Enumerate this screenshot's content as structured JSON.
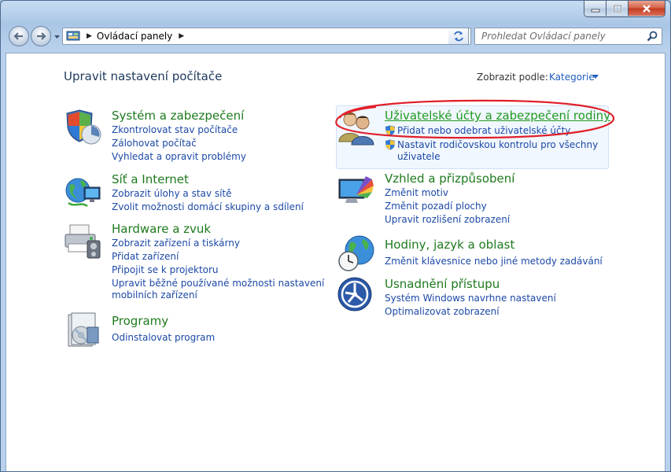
{
  "window": {
    "caption": {
      "minimize": "minimize",
      "maximize": "maximize",
      "close": "close"
    }
  },
  "navbar": {
    "address": "Ovládací panely",
    "search_placeholder": "Prohledat Ovládací panely"
  },
  "header": {
    "title": "Upravit nastavení počítače",
    "view_by_label": "Zobrazit podle:",
    "view_by_value": "Kategorie"
  },
  "categories": {
    "system": {
      "title": "Systém a zabezpečení",
      "links": [
        "Zkontrolovat stav počítače",
        "Zálohovat počítač",
        "Vyhledat a opravit problémy"
      ]
    },
    "network": {
      "title": "Síť a Internet",
      "links": [
        "Zobrazit úlohy a stav sítě",
        "Zvolit možnosti domácí skupiny a sdílení"
      ]
    },
    "hardware": {
      "title": "Hardware a zvuk",
      "links": [
        "Zobrazit zařízení a tiskárny",
        "Přidat zařízení",
        "Připojit se k projektoru",
        "Upravit běžné používané možnosti nastavení",
        "mobilních zařízení"
      ]
    },
    "programs": {
      "title": "Programy",
      "links": [
        "Odinstalovat program"
      ]
    },
    "users": {
      "title": "Uživatelské účty a zabezpečení rodiny",
      "links": [
        "Přidat nebo odebrat uživatelské účty",
        "Nastavit rodičovskou kontrolu pro všechny",
        "uživatele"
      ]
    },
    "appearance": {
      "title": "Vzhled a přizpůsobení",
      "links": [
        "Změnit motiv",
        "Změnit pozadí plochy",
        "Upravit rozlišení zobrazení"
      ]
    },
    "clock": {
      "title": "Hodiny, jazyk a oblast",
      "links": [
        "Změnit klávesnice nebo jiné metody zadávání"
      ]
    },
    "access": {
      "title": "Usnadnění přístupu",
      "links": [
        "Systém Windows navrhne nastavení",
        "Optimalizovat zobrazení"
      ]
    }
  },
  "colors": {
    "category_title": "#1e7a1e",
    "link": "#1c49a6",
    "annotation": "#e0202a"
  }
}
